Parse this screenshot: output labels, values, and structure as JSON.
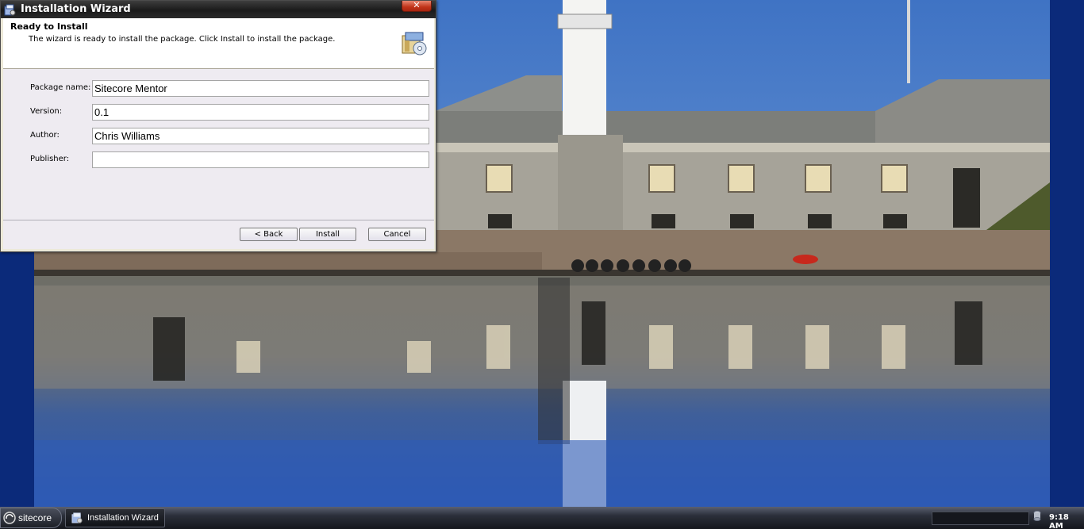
{
  "window": {
    "title": "Installation Wizard",
    "close_label": "✕",
    "header_title": "Ready to Install",
    "header_subtitle": "The wizard is ready to install the package. Click Install to install the package.",
    "fields": [
      {
        "label": "Package name:",
        "value": "Sitecore Mentor"
      },
      {
        "label": "Version:",
        "value": "0.1"
      },
      {
        "label": "Author:",
        "value": "Chris Williams"
      },
      {
        "label": "Publisher:",
        "value": ""
      }
    ],
    "buttons": {
      "back": "< Back",
      "install": "Install",
      "cancel": "Cancel"
    }
  },
  "taskbar": {
    "start_label": "sitecore",
    "tasks": [
      {
        "label": "Installation Wizard",
        "icon": "installer-icon"
      }
    ],
    "clock": "9:18 AM"
  },
  "colors": {
    "desktop_bg": "#0b2a7a",
    "titlebar": "#1a1a1a",
    "dialog_bg": "#eeebf1",
    "close_button": "#c1341a"
  }
}
